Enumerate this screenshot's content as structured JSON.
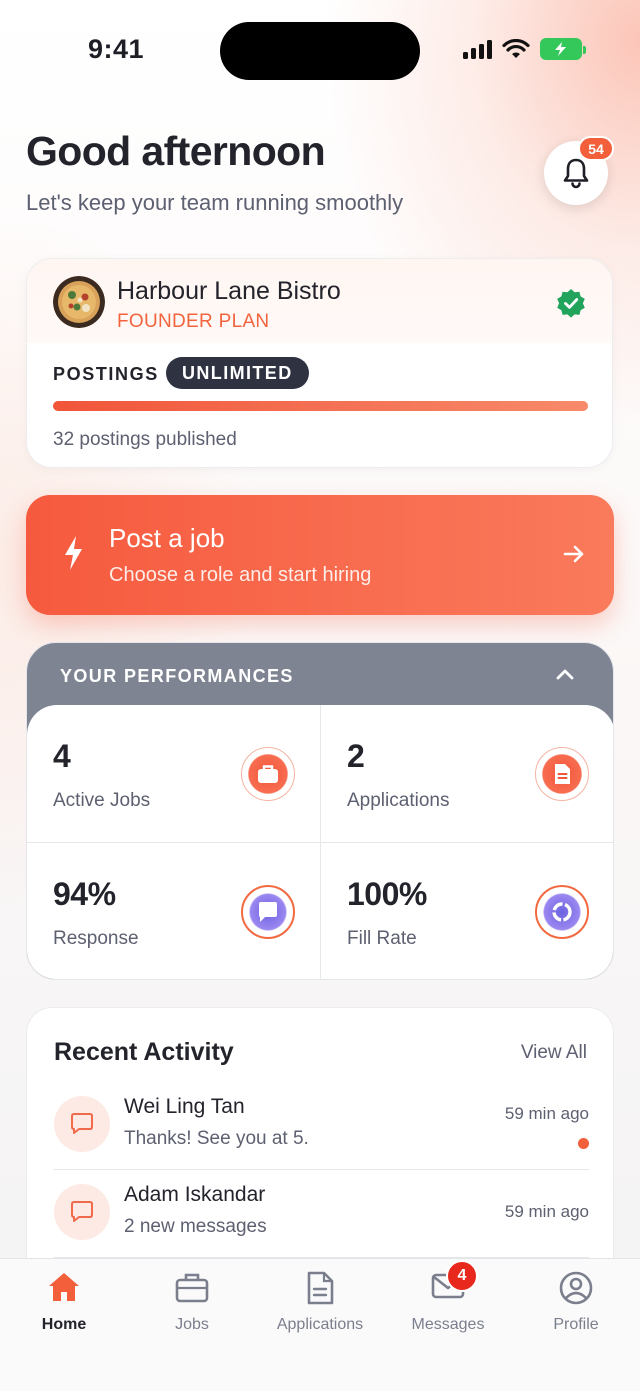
{
  "status_bar": {
    "time": "9:41"
  },
  "header": {
    "greeting": "Good afternoon",
    "subtitle": "Let's keep your team running smoothly",
    "notifications_count": "54"
  },
  "business": {
    "name": "Harbour Lane Bistro",
    "plan": "FOUNDER PLAN",
    "postings_label": "POSTINGS",
    "postings_limit": "UNLIMITED",
    "postings_progress": 1.0,
    "postings_published": "32 postings published"
  },
  "post_job": {
    "title": "Post a job",
    "subtitle": "Choose a role and start hiring"
  },
  "performance": {
    "title": "YOUR PERFORMANCES",
    "stats": [
      {
        "value": "4",
        "label": "Active Jobs",
        "icon": "briefcase-icon"
      },
      {
        "value": "2",
        "label": "Applications",
        "icon": "document-icon"
      },
      {
        "value": "94%",
        "label": "Response",
        "icon": "chat-icon"
      },
      {
        "value": "100%",
        "label": "Fill Rate",
        "icon": "cycle-icon"
      }
    ]
  },
  "recent_activity": {
    "title": "Recent Activity",
    "view_all": "View All",
    "items": [
      {
        "name": "Wei Ling Tan",
        "message": "Thanks! See you at 5.",
        "time": "59 min ago",
        "unread": true
      },
      {
        "name": "Adam Iskandar",
        "message": "2 new messages",
        "time": "59 min ago",
        "unread": false
      }
    ]
  },
  "tabs": [
    {
      "label": "Home",
      "icon": "home-icon",
      "active": true
    },
    {
      "label": "Jobs",
      "icon": "briefcase-icon",
      "active": false
    },
    {
      "label": "Applications",
      "icon": "document-icon",
      "active": false
    },
    {
      "label": "Messages",
      "icon": "mail-icon",
      "active": false,
      "badge": "4"
    },
    {
      "label": "Profile",
      "icon": "profile-icon",
      "active": false
    }
  ],
  "colors": {
    "accent": "#f25f3a",
    "dark": "#22232b",
    "muted": "#5d6070",
    "purple": "#7c6ee8",
    "verified": "#22a45d"
  }
}
